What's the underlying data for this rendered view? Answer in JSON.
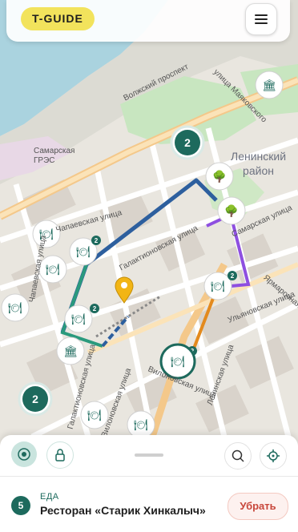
{
  "header": {
    "logo": "T-GUIDE",
    "menu_icon": "hamburger-icon"
  },
  "map": {
    "district": "Ленинский\nрайон",
    "power_station": "Самарская\nГРЭС",
    "streets": [
      "Волжский проспект",
      "улица Маяковского",
      "Самарская улица",
      "Ярмарочная улица",
      "Ульяновская улица",
      "Вилоновская улица",
      "Ленинская улица",
      "Галактионовская улица",
      "Чапаевская улица",
      "Вилоновская улица",
      "Галактионовская улица",
      "Самарская улица",
      "Чапаевская улица"
    ],
    "clusters": [
      "2",
      "2"
    ],
    "marker_count_badge": "2",
    "route_colors": {
      "blue": "#2d5f9e",
      "teal": "#2a9a7d",
      "purple": "#8e4fe0",
      "orange": "#e38a1e"
    },
    "poi_icons": [
      "restaurant-icon",
      "tree-icon",
      "theatre-icon",
      "location-pin-icon"
    ]
  },
  "bottom_sheet": {
    "controls": [
      "locate-icon",
      "lock-icon",
      "search-icon",
      "crosshair-icon"
    ],
    "item": {
      "number": "5",
      "category": "ЕДА",
      "name": "Ресторан «Старик Хинкалыч»",
      "remove_label": "Убрать"
    }
  }
}
